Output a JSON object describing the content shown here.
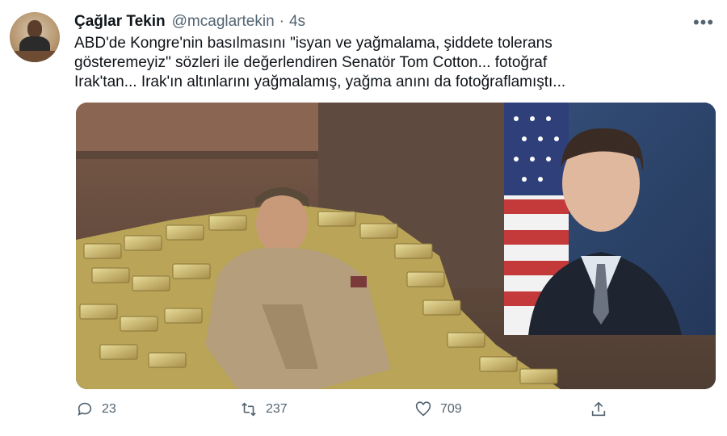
{
  "author": {
    "name": "Çağlar Tekin",
    "handle": "@mcaglartekin",
    "separator": "·",
    "time": "4s"
  },
  "tweet": {
    "lines": [
      "ABD'de Kongre'nin basılmasını \"isyan ve yağmalama, şiddete tolerans",
      "gösteremeyiz\" sözleri ile değerlendiren Senatör Tom Cotton... fotoğraf",
      "Irak'tan... Irak'ın altınlarını yağmalamış, yağma anını da fotoğraflamıştı..."
    ]
  },
  "menu": {
    "more_label": "•••"
  },
  "actions": {
    "reply_count": "23",
    "retweet_count": "237",
    "like_count": "709"
  },
  "icons": {
    "avatar": "avatar-photo",
    "more": "more-icon",
    "reply": "reply-icon",
    "retweet": "retweet-icon",
    "like": "heart-icon",
    "share": "share-icon"
  },
  "colors": {
    "text": "#0f1419",
    "secondary": "#536471",
    "gold": "#c9b46a"
  }
}
